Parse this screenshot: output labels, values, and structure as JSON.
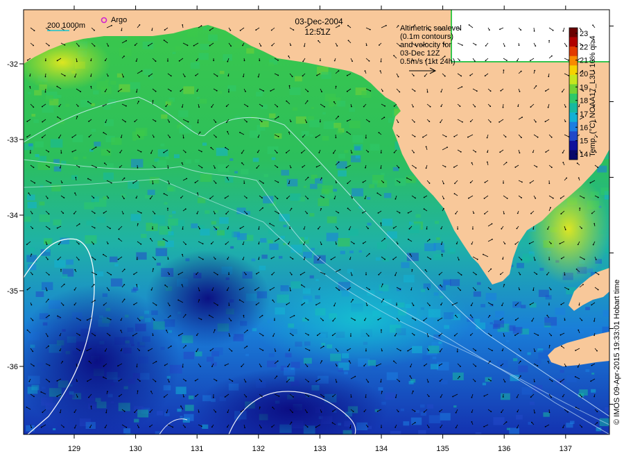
{
  "header": {
    "date": "03-Dec-2004",
    "time": "12:51Z"
  },
  "scale_bar": {
    "label": "200  1000m"
  },
  "legend_marker": {
    "label": "Argo"
  },
  "altimetry_note": {
    "lines": [
      "Altimetric sealevel",
      "(0.1m contours)",
      "and velocity for",
      "03-Dec 12Z",
      "0.5m/s (1kt 24h)"
    ]
  },
  "colorbar": {
    "label": "Temp. (°C) NOAA17_L3U 10% qi>4",
    "ticks": [
      "23",
      "22",
      "21",
      "20",
      "19",
      "18",
      "17",
      "16",
      "15",
      "14"
    ],
    "colors": [
      "#6a0000",
      "#b00000",
      "#e23a00",
      "#f88a00",
      "#f6d200",
      "#c6e61e",
      "#74d234",
      "#2ec86a",
      "#16b8a0",
      "#12b0d4",
      "#1c7ee0",
      "#2248c8",
      "#10109a",
      "#06066a"
    ]
  },
  "axes": {
    "x_ticks": [
      "129",
      "130",
      "131",
      "132",
      "133",
      "134",
      "135",
      "136",
      "137"
    ],
    "y_ticks": [
      "-32",
      "-33",
      "-34",
      "-35",
      "-36"
    ]
  },
  "credit": "© IMOS 09-Apr-2015 19:33:01 Hobart time",
  "colors": {
    "land": "#f8c89a",
    "contour": "#d8f0ff",
    "arrow": "#000000",
    "argo": "#d020d0"
  }
}
